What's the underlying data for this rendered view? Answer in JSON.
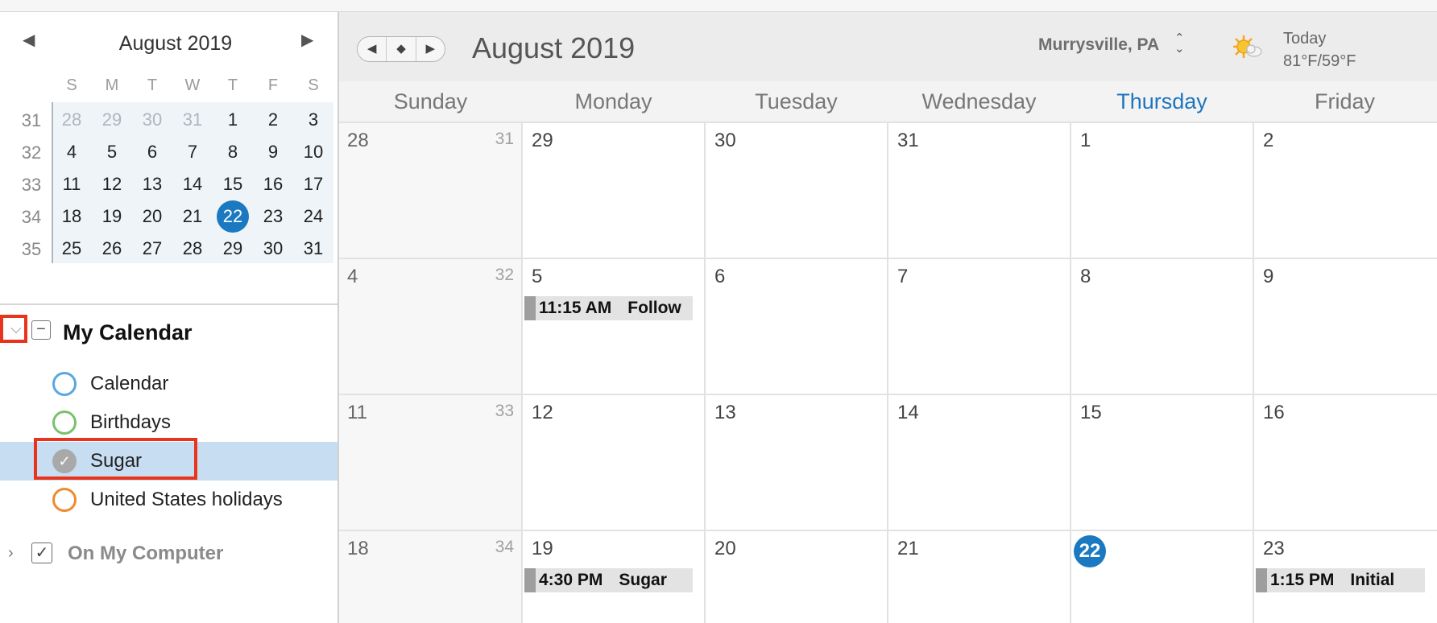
{
  "mini_calendar": {
    "title": "August 2019",
    "prev_arrow": "◀",
    "next_arrow": "▶",
    "weekdays": [
      "S",
      "M",
      "T",
      "W",
      "T",
      "F",
      "S"
    ],
    "weeks": [
      {
        "week": "31",
        "days": [
          "28",
          "29",
          "30",
          "31",
          "1",
          "2",
          "3"
        ]
      },
      {
        "week": "32",
        "days": [
          "4",
          "5",
          "6",
          "7",
          "8",
          "9",
          "10"
        ]
      },
      {
        "week": "33",
        "days": [
          "11",
          "12",
          "13",
          "14",
          "15",
          "16",
          "17"
        ]
      },
      {
        "week": "34",
        "days": [
          "18",
          "19",
          "20",
          "21",
          "22",
          "23",
          "24"
        ]
      },
      {
        "week": "35",
        "days": [
          "25",
          "26",
          "27",
          "28",
          "29",
          "30",
          "31"
        ]
      }
    ],
    "muted_days": [
      "28",
      "29",
      "30",
      "31"
    ],
    "today": "22"
  },
  "calendars": {
    "group_title": "My Calendar",
    "collapse_glyph": "⌵",
    "minus_glyph": "−",
    "items": [
      {
        "label": "Calendar",
        "color": "#5aa6e0"
      },
      {
        "label": "Birthdays",
        "color": "#79c26b"
      },
      {
        "label": "Sugar",
        "color": "#a9a9a9",
        "checked_glyph": "✓"
      },
      {
        "label": "United States holidays",
        "color": "#ef8a2e"
      }
    ],
    "group2_title": "On My Computer",
    "expand_glyph": "›",
    "check_glyph": "✓"
  },
  "toolbar": {
    "prev": "◀",
    "today_btn": "◆",
    "next": "▶",
    "title": "August 2019",
    "location": "Murrysville, PA",
    "location_arrows": "⌃⌄",
    "weather_icon": "partly-sunny-icon",
    "today_label": "Today",
    "temperature": "81°F/59°F"
  },
  "week_days": [
    "Sunday",
    "Monday",
    "Tuesday",
    "Wednesday",
    "Thursday",
    "Friday"
  ],
  "current_weekday": "Thursday",
  "month_grid": [
    {
      "week": "31",
      "days": [
        "28",
        "29",
        "30",
        "31",
        "1",
        "2"
      ]
    },
    {
      "week": "32",
      "days": [
        "4",
        "5",
        "6",
        "7",
        "8",
        "9"
      ]
    },
    {
      "week": "33",
      "days": [
        "11",
        "12",
        "13",
        "14",
        "15",
        "16"
      ]
    },
    {
      "week": "34",
      "days": [
        "18",
        "19",
        "20",
        "21",
        "22",
        "23"
      ]
    }
  ],
  "events": [
    {
      "week_index": 1,
      "day_index": 1,
      "time": "11:15 AM",
      "title": "Follow"
    },
    {
      "week_index": 3,
      "day_index": 1,
      "time": "4:30 PM",
      "title": "Sugar"
    },
    {
      "week_index": 3,
      "day_index": 5,
      "time": "1:15 PM",
      "title": "Initial"
    }
  ],
  "colors": {
    "accent": "#1a79c0",
    "highlight_box": "#e8341c",
    "selected_row": "#c7ddf1"
  }
}
